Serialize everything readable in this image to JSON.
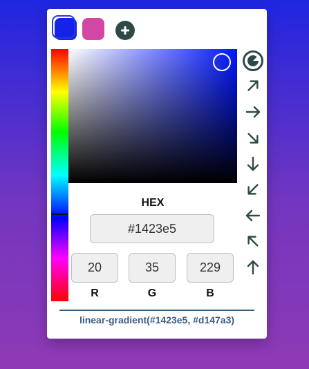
{
  "colors": {
    "swatch_1": "#1423e5",
    "swatch_2": "#d147a3",
    "current": "#1423e5",
    "icon": "#2d4a48",
    "pure_hue": "#0016ff"
  },
  "picker": {
    "hue_fraction": 0.653,
    "saturation": 0.91,
    "value": 0.9
  },
  "hex": {
    "label": "HEX",
    "value": "#1423e5"
  },
  "rgb": {
    "r": {
      "label": "R",
      "value": "20"
    },
    "g": {
      "label": "G",
      "value": "35"
    },
    "b": {
      "label": "B",
      "value": "229"
    }
  },
  "directions": [
    {
      "name": "radial-gradient-icon",
      "icon": "radial"
    },
    {
      "name": "arrow-up-right-icon",
      "rotation": 45
    },
    {
      "name": "arrow-right-icon",
      "rotation": 90
    },
    {
      "name": "arrow-down-right-icon",
      "rotation": 135
    },
    {
      "name": "arrow-down-icon",
      "rotation": 180
    },
    {
      "name": "arrow-down-left-icon",
      "rotation": 225
    },
    {
      "name": "arrow-left-icon",
      "rotation": 270
    },
    {
      "name": "arrow-up-left-icon",
      "rotation": 315
    },
    {
      "name": "arrow-up-icon",
      "rotation": 0
    }
  ],
  "output": {
    "gradient_css": "linear-gradient(#1423e5, #d147a3)"
  }
}
